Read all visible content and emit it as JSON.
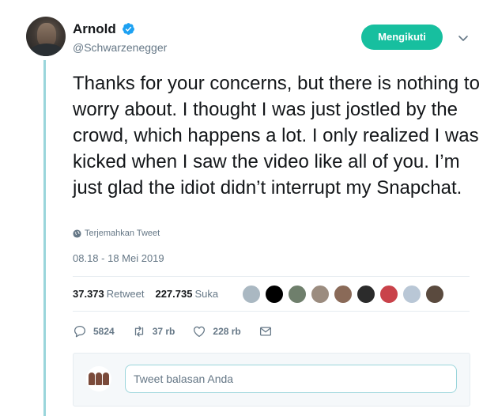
{
  "tweet": {
    "author": {
      "display_name": "Arnold",
      "handle": "@Schwarzenegger",
      "verified": true
    },
    "follow_button_label": "Mengikuti",
    "text": "Thanks for your concerns, but there is nothing to worry about. I thought I was just jostled by the crowd, which happens a lot. I only realized I was kicked when I saw the video like all of you. I’m just glad the idiot didn’t interrupt my Snapchat.",
    "translate_label": "Terjemahkan Tweet",
    "timestamp": "08.18 - 18 Mei 2019"
  },
  "stats": {
    "retweets_count": "37.373",
    "retweets_label": "Retweet",
    "likes_count": "227.735",
    "likes_label": "Suka"
  },
  "likers": [
    {
      "color": "#aab8c2"
    },
    {
      "color": "#000000"
    },
    {
      "color": "#6f7f6c"
    },
    {
      "color": "#9b8c7f"
    },
    {
      "color": "#8a6a58"
    },
    {
      "color": "#2b2b2b"
    },
    {
      "color": "#c9424a"
    },
    {
      "color": "#b9c7d6"
    },
    {
      "color": "#5a4a3e"
    }
  ],
  "actions": {
    "replies": "5824",
    "retweets": "37 rb",
    "likes": "228 rb"
  },
  "reply": {
    "placeholder": "Tweet balasan Anda"
  },
  "colors": {
    "accent": "#1da1f2",
    "follow_button": "#17bf9f",
    "thread_line": "#9ad5db",
    "secondary_text": "#657786"
  }
}
